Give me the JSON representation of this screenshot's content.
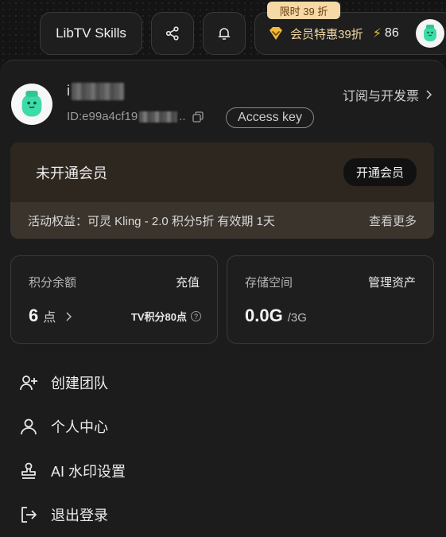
{
  "header": {
    "app_button": "LibTV Skills",
    "share_icon": "share-icon",
    "bell_icon": "bell-icon",
    "promo_badge": "限时 39 折",
    "member_offer": "会员特惠39折",
    "points": "86",
    "bolt_icon": "lightning-icon"
  },
  "profile": {
    "username_visible": "i",
    "id_visible_start": "ID:e99a4cf19",
    "id_visible_end": "..",
    "access_key": "Access key",
    "invoice": "订阅与开发票"
  },
  "membership": {
    "title": "未开通会员",
    "button": "开通会员",
    "benefit": "活动权益：可灵 Kling - 2.0 积分5折 有效期 1天",
    "more": "查看更多"
  },
  "balance_card": {
    "label": "积分余额",
    "action": "充值",
    "amount": "6",
    "unit": "点",
    "tv_points": "TV积分80点"
  },
  "storage_card": {
    "label": "存储空间",
    "action": "管理资产",
    "used": "0.0G",
    "total": "/3G"
  },
  "menu": [
    {
      "label": "创建团队",
      "icon": "add-user-icon"
    },
    {
      "label": "个人中心",
      "icon": "user-icon"
    },
    {
      "label": "AI 水印设置",
      "icon": "stamp-icon"
    },
    {
      "label": "退出登录",
      "icon": "logout-icon"
    }
  ],
  "colors": {
    "accent_gold": "#f1d7a4",
    "badge_bg": "#f6d9a6",
    "mint": "#3ddba8"
  }
}
